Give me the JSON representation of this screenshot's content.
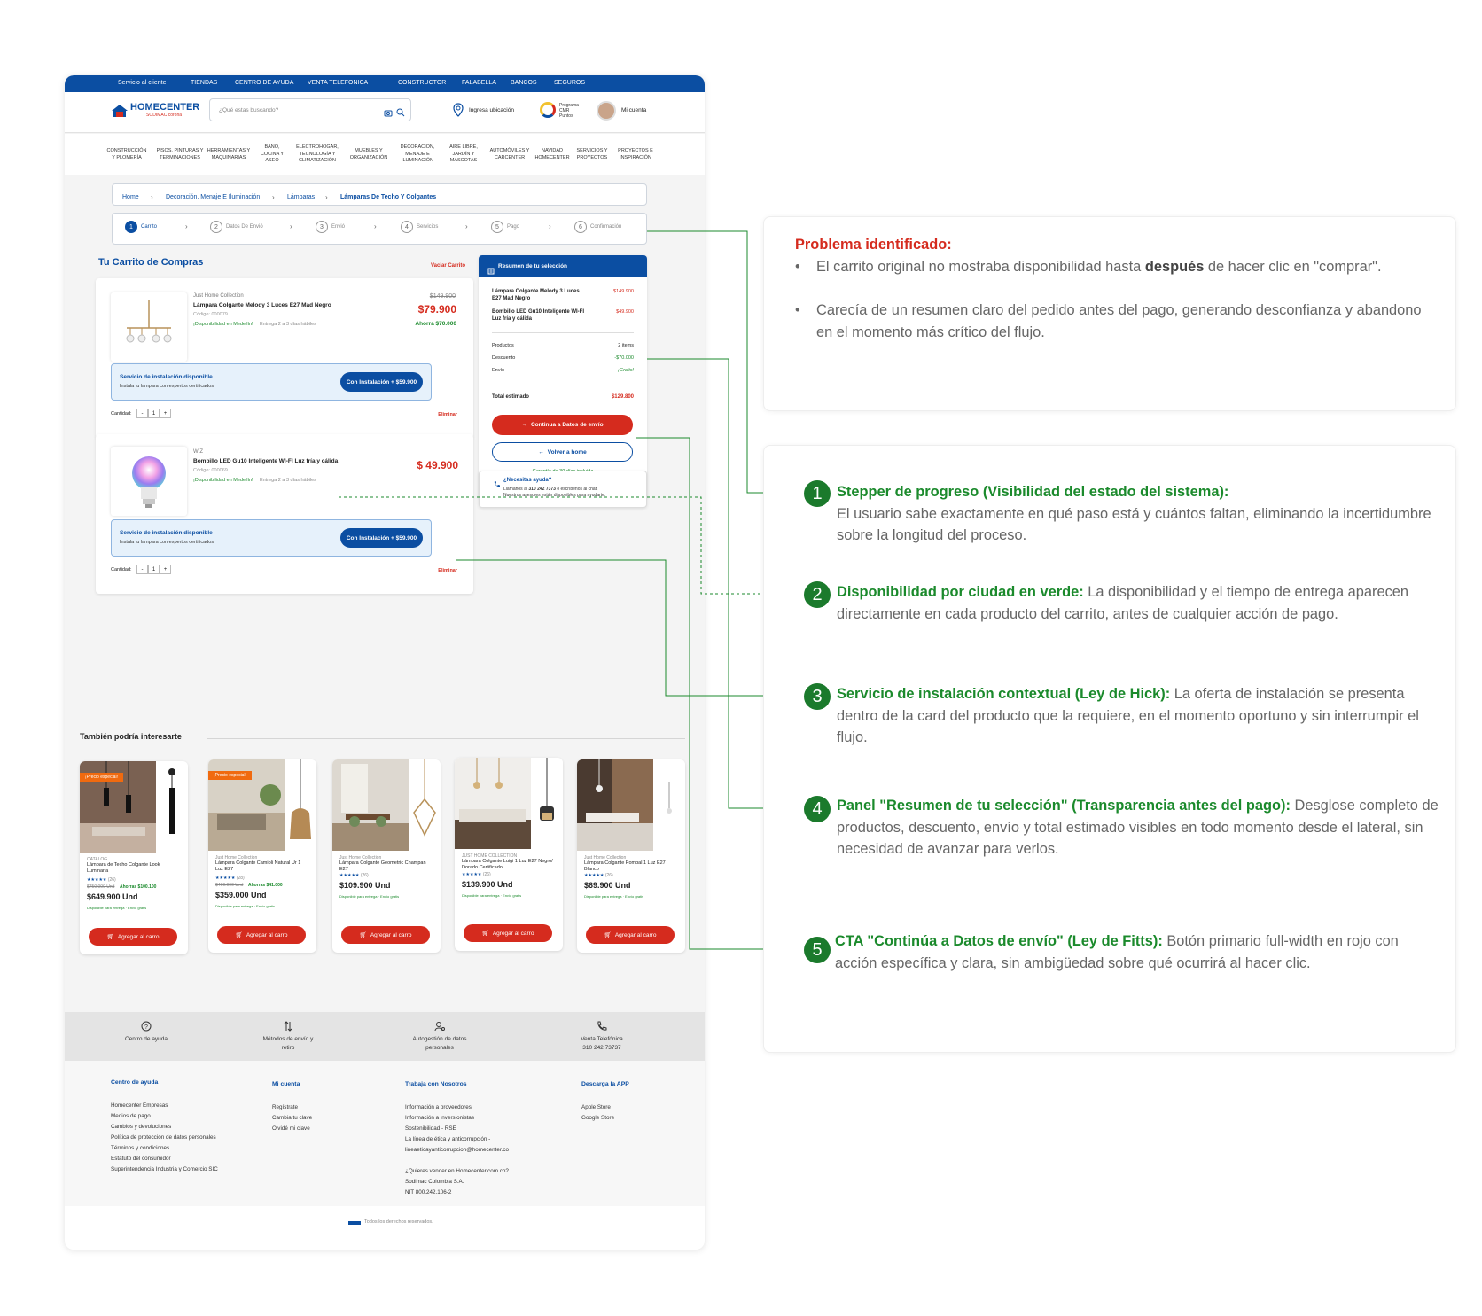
{
  "topbar": {
    "items": [
      "Servicio al cliente",
      "TIENDAS",
      "CENTRO DE AYUDA",
      "VENTA TELEFONICA",
      "CONSTRUCTOR",
      "FALABELLA",
      "BANCOS",
      "SEGUROS"
    ]
  },
  "header": {
    "logo_main": "HOMECENTER",
    "logo_sub": "SODIMAC corona",
    "search_placeholder": "¿Qué estas buscando?",
    "location_label": "Ingresa ubicación",
    "cmr_label": "Programa\nCMR\nPuntos",
    "account_label": "Mi cuenta"
  },
  "categories": [
    "CONSTRUCCIÓN\nY PLOMERÍA",
    "PISOS, PINTURAS Y\nTERMINACIONES",
    "HERRAMIENTAS Y\nMAQUINARIAS",
    "BAÑO,\nCOCINA Y\nASEO",
    "ELECTROHOGAR,\nTECNOLOGÍA Y\nCLIMATIZACIÓN",
    "MUEBLES Y\nORGANIZACIÓN",
    "DECORACIÓN,\nMENAJE E\nILUMINACIÓN",
    "AIRE LIBRE,\nJARDÍN Y\nMASCOTAS",
    "AUTOMÓVILES Y\nCARCENTER",
    "NAVIDAD\nHOMECENTER",
    "SERVICIOS Y\nPROYECTOS",
    "PROYECTOS E\nINSPIRACIÓN"
  ],
  "breadcrumb": [
    "Home",
    "Decoración, Menaje E Iluminación",
    "Lámparas",
    "Lámparas De Techo Y Colgantes"
  ],
  "stepper": [
    {
      "n": "1",
      "label": "Carrito"
    },
    {
      "n": "2",
      "label": "Datos De Envió"
    },
    {
      "n": "3",
      "label": "Envió"
    },
    {
      "n": "4",
      "label": "Servicios"
    },
    {
      "n": "5",
      "label": "Pago"
    },
    {
      "n": "6",
      "label": "Confirmación"
    }
  ],
  "cart": {
    "title": "Tu Carrito de Compras",
    "empty_label": "Vaciar Carrito",
    "items": [
      {
        "brand": "Just Home Collection",
        "name": "Lámpara Colgante Melody 3 Luces E27 Mad  Negro",
        "code": "Código: 000079",
        "old_price": "$149.900",
        "price": "$79.900",
        "savings": "Ahorra $70.000",
        "availability": "¡Disponibilidad en Medellín!",
        "delivery": "Entrega 2 a 3 días hábiles"
      },
      {
        "brand": "WIZ",
        "name": "Bombillo LED Gu10 Inteligente WI-FI Luz fría y cálida",
        "code": "Código: 000069",
        "old_price": "",
        "price": "$ 49.900",
        "savings": "",
        "availability": "¡Disponibilidad en Medellín!",
        "delivery": "Entrega 2 a 3 días hábiles"
      }
    ],
    "service_title": "Servicio de instalación disponible",
    "service_desc": "Instala tu lampara con expertos certificados",
    "service_button": "Con Instalación + $59.900",
    "qty_label": "Cantidad:",
    "qty_value": "1",
    "qty_minus": "-",
    "qty_plus": "+",
    "remove_label": "Eliminar"
  },
  "summary": {
    "title": "Resumen de tu selección",
    "lines": [
      {
        "name": "Lámpara Colgante Melody 3 Luces E27 Mad  Negro",
        "price": "$149.900"
      },
      {
        "name": "Bombillo LED Gu10 Inteligente WI-FI Luz fría y cálida",
        "price": "$49.900"
      }
    ],
    "products_label": "Productos",
    "products_value": "2 items",
    "discount_label": "Descuento",
    "discount_value": "-$70.000",
    "shipping_label": "Envío",
    "shipping_value": "¡Gratis!",
    "total_label": "Total estimado",
    "total_value": "$129.800",
    "cta": "Continua a Datos de envío",
    "back": "Volver a home",
    "guarantee": "Garantía de 30 días incluida"
  },
  "help": {
    "title": "¿Necesitas ayuda?",
    "text_pre": "Llámanos al ",
    "phone": "310 242 7373",
    "text_post": " o escríbenos al chat.",
    "text2": "Nuestros asesores están disponibles para ayudarte."
  },
  "recommendations": {
    "title": "También podría interesarte",
    "items": [
      {
        "promo": "¡Precio especial!",
        "brand": "CATALOG",
        "name": "Lámpara de Techo Colgante Look Luminaria",
        "old": "$750.000 Und",
        "save": "Ahorras $100.100",
        "rating": "(26)",
        "price": "$649.900 Und",
        "note": "Disponible para entrega · Envío gratis",
        "cta": "Agregar al carro"
      },
      {
        "promo": "¡Precio especial!",
        "brand": "Just Home Collection",
        "name": "Lámpara Colgante Camioli Natural Ur 1 Luz E27",
        "old": "$400.000 Und",
        "save": "Ahorras $41.000",
        "rating": "(28)",
        "price": "$359.000 Und",
        "note": "Disponible para entrega · Envío gratis",
        "cta": "Agregar al carro"
      },
      {
        "promo": "",
        "brand": "Just Home Collection",
        "name": "Lámpara Colgante Geometric Champan E27",
        "old": "",
        "save": "",
        "rating": "(26)",
        "price": "$109.900 Und",
        "note": "Disponible para entrega · Envío gratis",
        "cta": "Agregar al carro"
      },
      {
        "promo": "",
        "brand": "JUST HOME COLLECTION",
        "name": "Lámpara Colgante Luigi 1 Luz E27 Negro/ Dorado Certificado",
        "old": "",
        "save": "",
        "rating": "(26)",
        "price": "$139.900 Und",
        "note": "Disponible para entrega · Envío gratis",
        "cta": "Agregar al carro"
      },
      {
        "promo": "",
        "brand": "Just Home Collection",
        "name": "Lámpara Colgante Pombal 1 Luz E27 Blanco",
        "old": "",
        "save": "",
        "rating": "(26)",
        "price": "$69.900 Und",
        "note": "Disponible para entrega · Envío gratis",
        "cta": "Agregar al carro"
      }
    ]
  },
  "footer_icons": [
    {
      "label": "Centro de ayuda",
      "icon": "help-icon"
    },
    {
      "label": "Métodos de envío y retiro",
      "icon": "transfer-icon"
    },
    {
      "label": "Autogestión de datos personales",
      "icon": "user-settings-icon"
    },
    {
      "label": "Venta Telefónica\n310 242 73737",
      "icon": "phone-icon"
    }
  ],
  "footer_cols": [
    {
      "title": "Centro de ayuda",
      "links": [
        "Homecenter Empresas",
        "Medios de pago",
        "Cambios y devoluciones",
        "Política de protección de datos personales",
        "Términos y condiciones",
        "Estatuto del consumidor",
        "Superintendencia Industria y Comercio SIC"
      ]
    },
    {
      "title": "Mi cuenta",
      "links": [
        "Regístrate",
        "Cambia tu clave",
        "Olvidé mi clave"
      ]
    },
    {
      "title": "Trabaja con Nosotros",
      "links": [
        "Información a proveedores",
        "Información a inversionistas",
        "Sostenibilidad - RSE",
        "La línea de ética y anticorrupción -",
        "lineaeticayanticorrupcion@homecenter.co",
        "",
        "¿Quieres vender en Homecenter.com.co?",
        "Sodimac Colombia S.A.",
        "NIT 800.242.106-2"
      ]
    },
    {
      "title": "Descarga la APP",
      "links": [
        "Apple Store",
        "Google Store"
      ]
    }
  ],
  "copyright": "Todos los derechos reservados.",
  "problem": {
    "title": "Problema identificado:",
    "b1_pre": "El carrito original no mostraba disponibilidad hasta ",
    "b1_bold": "después",
    "b1_post": " de hacer clic en \"comprar\".",
    "b2": "Carecía de un resumen claro del pedido antes del pago, generando desconfianza y abandono en el momento más crítico del flujo."
  },
  "annotations": [
    {
      "n": "1",
      "title": "Stepper de progreso (Visibilidad del estado del sistema):",
      "text": " El usuario sabe exactamente en qué paso está y cuántos faltan, eliminando la incertidumbre sobre la longitud del proceso."
    },
    {
      "n": "2",
      "title": "Disponibilidad por ciudad en verde:",
      "text": " La disponibilidad y el tiempo de entrega aparecen directamente en cada producto del carrito, antes de cualquier acción de pago."
    },
    {
      "n": "3",
      "title": "Servicio de instalación contextual (Ley de Hick):",
      "text": " La oferta de instalación se presenta dentro de la card del producto que la requiere, en el momento oportuno y sin interrumpir el flujo."
    },
    {
      "n": "4",
      "title": "Panel \"Resumen de tu selección\" (Transparencia antes del pago):",
      "text": " Desglose completo de productos, descuento, envío y total estimado visibles en todo momento desde el lateral, sin necesidad de avanzar para verlos."
    },
    {
      "n": "5",
      "title": "CTA \"Continúa a Datos de envío\" (Ley de Fitts):",
      "text": " Botón primario full-width en rojo con acción específica y clara, sin ambigüedad sobre qué ocurrirá al hacer clic."
    }
  ]
}
